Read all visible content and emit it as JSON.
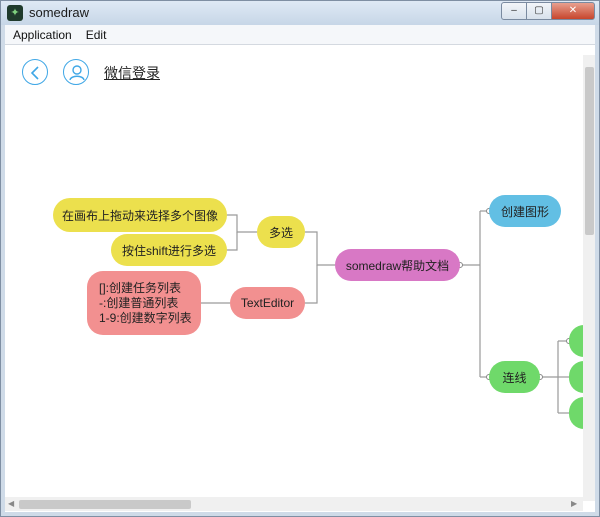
{
  "window": {
    "title": "somedraw",
    "icon": "app-icon",
    "buttons": {
      "minimize": "‒",
      "maximize": "▢",
      "close": "✕"
    }
  },
  "menu": [
    {
      "label": "Application"
    },
    {
      "label": "Edit"
    }
  ],
  "nav": {
    "back_icon": "chevron-left-icon",
    "user_icon": "user-icon",
    "title": "微信登录"
  },
  "mindmap": {
    "root": "somedraw帮助文档",
    "left": [
      {
        "label": "多选",
        "children": [
          "在画布上拖动来选择多个图像",
          "按住shift进行多选"
        ]
      },
      {
        "label": "TextEditor",
        "children": [
          [
            "[]:创建任务列表",
            "-:创建普通列表",
            "1-9:创建数字列表"
          ]
        ]
      }
    ],
    "right": [
      {
        "label": "创建图形"
      },
      {
        "label": "连线",
        "children": [
          "",
          "",
          ""
        ]
      }
    ]
  },
  "colors": {
    "yellow": "#ece04d",
    "pink": "#f29090",
    "magenta": "#d878c5",
    "blue": "#62bfe4",
    "green": "#6fd96a",
    "nav_accent": "#3fa7e6"
  }
}
